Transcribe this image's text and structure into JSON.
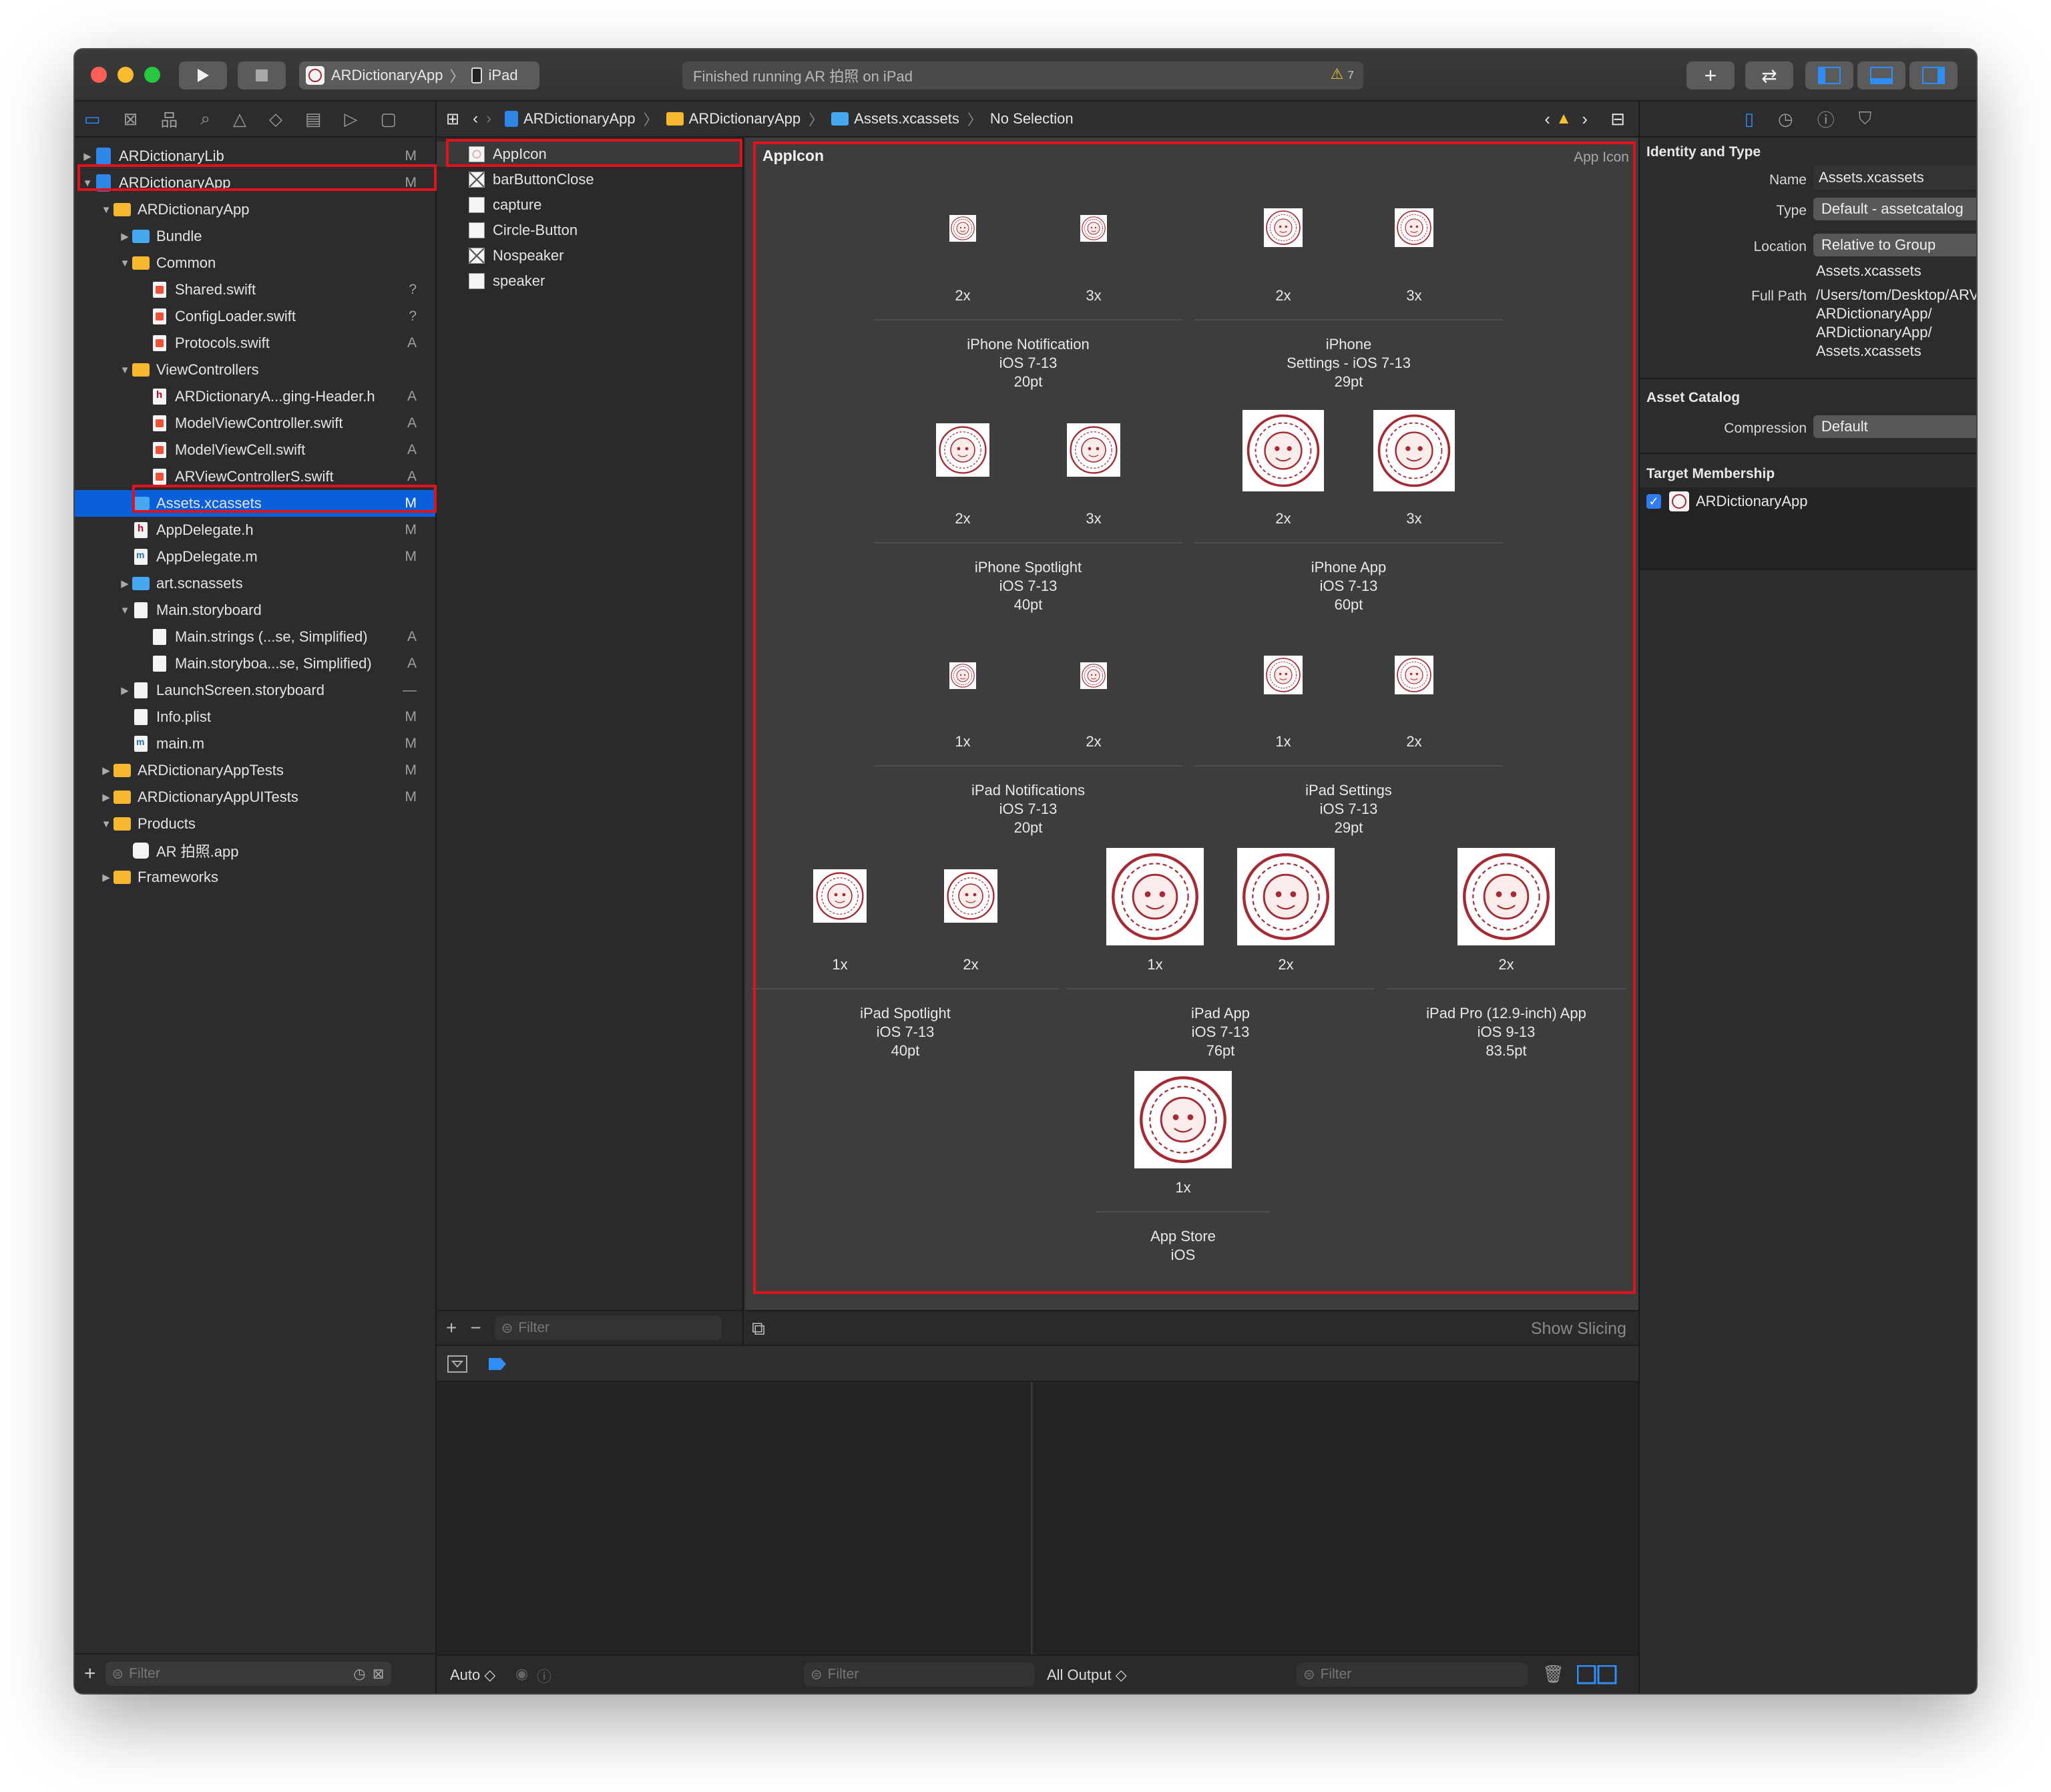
{
  "toolbar": {
    "scheme": "ARDictionaryApp",
    "device": "iPad",
    "status": "Finished running AR 拍照 on iPad",
    "warning_count": "7",
    "add_label": "+",
    "review_label": "⇄"
  },
  "navigator": {
    "tabs": [
      "project",
      "source-control",
      "symbols",
      "find",
      "issues",
      "tests",
      "debug",
      "breakpoints",
      "reports"
    ],
    "tree": [
      {
        "label": "ARDictionaryLib",
        "depth": 0,
        "kind": "project",
        "disc": "closed",
        "badge": "M"
      },
      {
        "label": "ARDictionaryApp",
        "depth": 0,
        "kind": "project",
        "disc": "open",
        "badge": "M"
      },
      {
        "label": "ARDictionaryApp",
        "depth": 1,
        "kind": "folder",
        "disc": "open",
        "badge": ""
      },
      {
        "label": "Bundle",
        "depth": 2,
        "kind": "folder-blue",
        "disc": "closed",
        "badge": ""
      },
      {
        "label": "Common",
        "depth": 2,
        "kind": "folder",
        "disc": "open",
        "badge": ""
      },
      {
        "label": "Shared.swift",
        "depth": 3,
        "kind": "swift",
        "disc": "",
        "badge": "?"
      },
      {
        "label": "ConfigLoader.swift",
        "depth": 3,
        "kind": "swift",
        "disc": "",
        "badge": "?"
      },
      {
        "label": "Protocols.swift",
        "depth": 3,
        "kind": "swift",
        "disc": "",
        "badge": "A"
      },
      {
        "label": "ViewControllers",
        "depth": 2,
        "kind": "folder",
        "disc": "open",
        "badge": ""
      },
      {
        "label": "ARDictionaryA...ging-Header.h",
        "depth": 3,
        "kind": "h",
        "disc": "",
        "badge": "A"
      },
      {
        "label": "ModelViewController.swift",
        "depth": 3,
        "kind": "swift",
        "disc": "",
        "badge": "A"
      },
      {
        "label": "ModelViewCell.swift",
        "depth": 3,
        "kind": "swift",
        "disc": "",
        "badge": "A"
      },
      {
        "label": "ARViewControllerS.swift",
        "depth": 3,
        "kind": "swift",
        "disc": "",
        "badge": "A"
      },
      {
        "label": "Assets.xcassets",
        "depth": 2,
        "kind": "folder-blue",
        "disc": "",
        "badge": "M",
        "selected": true
      },
      {
        "label": "AppDelegate.h",
        "depth": 2,
        "kind": "h",
        "disc": "",
        "badge": "M"
      },
      {
        "label": "AppDelegate.m",
        "depth": 2,
        "kind": "m",
        "disc": "",
        "badge": "M"
      },
      {
        "label": "art.scnassets",
        "depth": 2,
        "kind": "folder-blue",
        "disc": "closed",
        "badge": ""
      },
      {
        "label": "Main.storyboard",
        "depth": 2,
        "kind": "file",
        "disc": "open",
        "badge": ""
      },
      {
        "label": "Main.strings (...se, Simplified)",
        "depth": 3,
        "kind": "file",
        "disc": "",
        "badge": "A"
      },
      {
        "label": "Main.storyboa...se, Simplified)",
        "depth": 3,
        "kind": "file",
        "disc": "",
        "badge": "A"
      },
      {
        "label": "LaunchScreen.storyboard",
        "depth": 2,
        "kind": "file",
        "disc": "closed",
        "badge": "—"
      },
      {
        "label": "Info.plist",
        "depth": 2,
        "kind": "file",
        "disc": "",
        "badge": "M"
      },
      {
        "label": "main.m",
        "depth": 2,
        "kind": "m",
        "disc": "",
        "badge": "M"
      },
      {
        "label": "ARDictionaryAppTests",
        "depth": 1,
        "kind": "folder",
        "disc": "closed",
        "badge": "M"
      },
      {
        "label": "ARDictionaryAppUITests",
        "depth": 1,
        "kind": "folder",
        "disc": "closed",
        "badge": "M"
      },
      {
        "label": "Products",
        "depth": 1,
        "kind": "folder",
        "disc": "open",
        "badge": ""
      },
      {
        "label": "AR 拍照.app",
        "depth": 2,
        "kind": "app",
        "disc": "",
        "badge": ""
      },
      {
        "label": "Frameworks",
        "depth": 1,
        "kind": "folder",
        "disc": "closed",
        "badge": ""
      }
    ],
    "filter_placeholder": "Filter"
  },
  "jumpbar": {
    "crumbs": [
      "ARDictionaryApp",
      "ARDictionaryApp",
      "Assets.xcassets",
      "No Selection"
    ]
  },
  "assets": {
    "items": [
      {
        "label": "AppIcon",
        "thumb": "icon",
        "selected": true
      },
      {
        "label": "barButtonClose",
        "thumb": "x"
      },
      {
        "label": "capture",
        "thumb": "blank"
      },
      {
        "label": "Circle-Button",
        "thumb": "blank"
      },
      {
        "label": "Nospeaker",
        "thumb": "x"
      },
      {
        "label": "speaker",
        "thumb": "blank"
      }
    ],
    "filter_placeholder": "Filter"
  },
  "editor": {
    "title": "AppIcon",
    "type_label": "App Icon",
    "show_slicing": "Show Slicing",
    "groups": [
      {
        "lines": [
          "iPhone Notification",
          "iOS 7-13",
          "20pt"
        ],
        "scales": [
          "2x",
          "3x"
        ]
      },
      {
        "lines": [
          "iPhone",
          "Settings - iOS 7-13",
          "29pt"
        ],
        "scales": [
          "2x",
          "3x"
        ]
      },
      {
        "lines": [
          "iPhone Spotlight",
          "iOS 7-13",
          "40pt"
        ],
        "scales": [
          "2x",
          "3x"
        ]
      },
      {
        "lines": [
          "iPhone App",
          "iOS 7-13",
          "60pt"
        ],
        "scales": [
          "2x",
          "3x"
        ]
      },
      {
        "lines": [
          "iPad Notifications",
          "iOS 7-13",
          "20pt"
        ],
        "scales": [
          "1x",
          "2x"
        ]
      },
      {
        "lines": [
          "iPad Settings",
          "iOS 7-13",
          "29pt"
        ],
        "scales": [
          "1x",
          "2x"
        ]
      },
      {
        "lines": [
          "iPad Spotlight",
          "iOS 7-13",
          "40pt"
        ],
        "scales": [
          "1x",
          "2x"
        ]
      },
      {
        "lines": [
          "iPad App",
          "iOS 7-13",
          "76pt"
        ],
        "scales": [
          "1x",
          "2x"
        ]
      },
      {
        "lines": [
          "iPad Pro (12.9-inch) App",
          "iOS 9-13",
          "83.5pt"
        ],
        "scales": [
          "2x"
        ]
      },
      {
        "lines": [
          "App Store",
          "iOS"
        ],
        "scales": [
          "1x"
        ]
      }
    ]
  },
  "debug": {
    "auto_label": "Auto ◇",
    "output_label": "All Output ◇",
    "filter_placeholder": "Filter"
  },
  "inspector": {
    "identity_title": "Identity and Type",
    "name_label": "Name",
    "name_value": "Assets.xcassets",
    "type_label": "Type",
    "type_value": "Default - assetcatalog",
    "location_label": "Location",
    "location_value": "Relative to Group",
    "location_file": "Assets.xcassets",
    "fullpath_label": "Full Path",
    "fullpath_lines": [
      "/Users/tom/Desktop/ARView/",
      "ARDictionaryApp/",
      "ARDictionaryApp/",
      "Assets.xcassets"
    ],
    "catalog_title": "Asset Catalog",
    "compression_label": "Compression",
    "compression_value": "Default",
    "membership_title": "Target Membership",
    "membership_target": "ARDictionaryApp"
  },
  "colors": {
    "selection": "#0a60d8",
    "highlight_box": "#e0121c",
    "icon_red": "#a52a34",
    "accent": "#2f7ef0",
    "warning": "#f2c230"
  }
}
